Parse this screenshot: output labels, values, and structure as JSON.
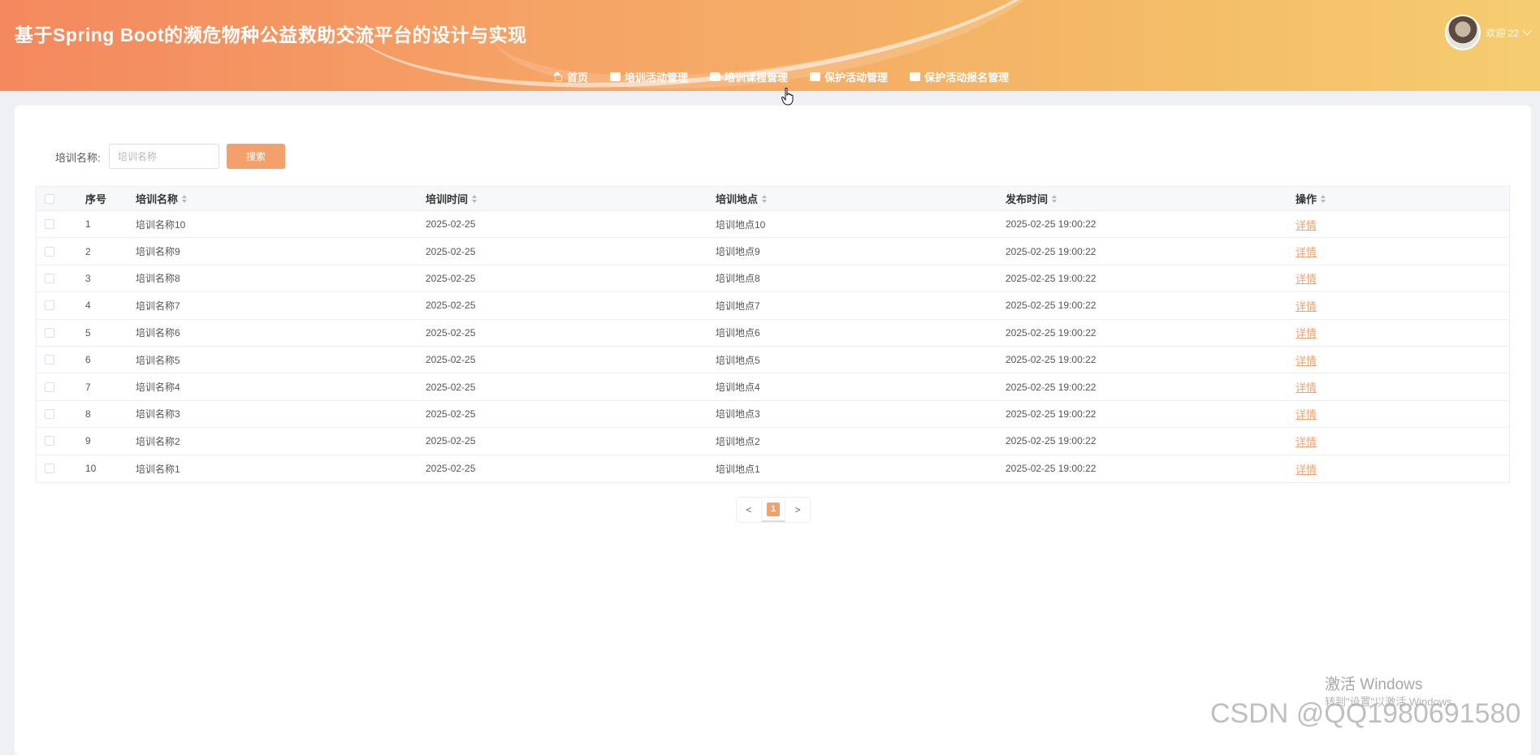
{
  "header": {
    "title": "基于Spring Boot的濒危物种公益救助交流平台的设计与实现",
    "welcome": "欢迎 22",
    "nav": [
      {
        "label": "首页",
        "icon": "home-icon"
      },
      {
        "label": "培训活动管理",
        "icon": "table-icon"
      },
      {
        "label": "培训课程管理",
        "icon": "book-icon"
      },
      {
        "label": "保护活动管理",
        "icon": "table-icon"
      },
      {
        "label": "保护活动报名管理",
        "icon": "table-icon"
      }
    ]
  },
  "search": {
    "label": "培训名称:",
    "placeholder": "培训名称",
    "button": "搜索"
  },
  "table": {
    "headers": [
      "序号",
      "培训名称",
      "培训时间",
      "培训地点",
      "发布时间",
      "操作"
    ],
    "rows": [
      [
        "1",
        "培训名称10",
        "2025-02-25",
        "培训地点10",
        "2025-02-25 19:00:22",
        "详情"
      ],
      [
        "2",
        "培训名称9",
        "2025-02-25",
        "培训地点9",
        "2025-02-25 19:00:22",
        "详情"
      ],
      [
        "3",
        "培训名称8",
        "2025-02-25",
        "培训地点8",
        "2025-02-25 19:00:22",
        "详情"
      ],
      [
        "4",
        "培训名称7",
        "2025-02-25",
        "培训地点7",
        "2025-02-25 19:00:22",
        "详情"
      ],
      [
        "5",
        "培训名称6",
        "2025-02-25",
        "培训地点6",
        "2025-02-25 19:00:22",
        "详情"
      ],
      [
        "6",
        "培训名称5",
        "2025-02-25",
        "培训地点5",
        "2025-02-25 19:00:22",
        "详情"
      ],
      [
        "7",
        "培训名称4",
        "2025-02-25",
        "培训地点4",
        "2025-02-25 19:00:22",
        "详情"
      ],
      [
        "8",
        "培训名称3",
        "2025-02-25",
        "培训地点3",
        "2025-02-25 19:00:22",
        "详情"
      ],
      [
        "9",
        "培训名称2",
        "2025-02-25",
        "培训地点2",
        "2025-02-25 19:00:22",
        "详情"
      ],
      [
        "10",
        "培训名称1",
        "2025-02-25",
        "培训地点1",
        "2025-02-25 19:00:22",
        "详情"
      ]
    ]
  },
  "pagination": {
    "prev": "<",
    "current": "1",
    "next": ">"
  },
  "overlay": {
    "activate_title": "激活 Windows",
    "activate_sub": "转到\"设置\"以激活 Windows。",
    "watermark": "CSDN @QQ1980691580"
  },
  "colors": {
    "accent": "#f4a06c",
    "header_start": "#f4885e",
    "header_end": "#f5cd70"
  }
}
